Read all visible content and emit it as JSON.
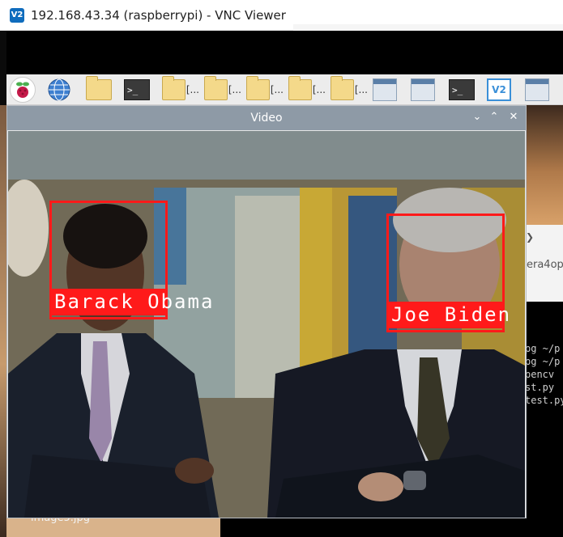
{
  "window": {
    "title": "192.168.43.34 (raspberrypi) - VNC Viewer",
    "app_icon": "V2"
  },
  "taskbar": {
    "items": [
      {
        "icon": "raspberry-pi-menu-icon",
        "label": ""
      },
      {
        "icon": "web-browser-globe-icon",
        "label": ""
      },
      {
        "icon": "file-manager-icon",
        "label": ""
      },
      {
        "icon": "terminal-icon",
        "label": ""
      },
      {
        "icon": "folder-icon",
        "label": "[..."
      },
      {
        "icon": "folder-icon",
        "label": "[..."
      },
      {
        "icon": "folder-icon",
        "label": "[..."
      },
      {
        "icon": "folder-icon",
        "label": "[..."
      },
      {
        "icon": "folder-icon",
        "label": "[..."
      },
      {
        "icon": "window-icon",
        "label": ""
      },
      {
        "icon": "window-icon",
        "label": ""
      },
      {
        "icon": "terminal-icon",
        "label": ""
      },
      {
        "icon": "vnc-icon",
        "label": ""
      },
      {
        "icon": "window-icon",
        "label": ""
      }
    ]
  },
  "video_window": {
    "title": "Video",
    "controls": {
      "minimize": "⌄",
      "maximize": "⌃",
      "close": "✕"
    },
    "detections": [
      {
        "name": "Barack Obama"
      },
      {
        "name": "Joe Biden"
      }
    ],
    "box_color": "#ff1a1a"
  },
  "background": {
    "partial_text": "era4op",
    "terminal_lines": [
      "pg ~/p",
      "pg ~/p",
      "pencv",
      "st.py",
      "test.py"
    ],
    "file_label": "image5.jpg",
    "chevron": "❯"
  }
}
